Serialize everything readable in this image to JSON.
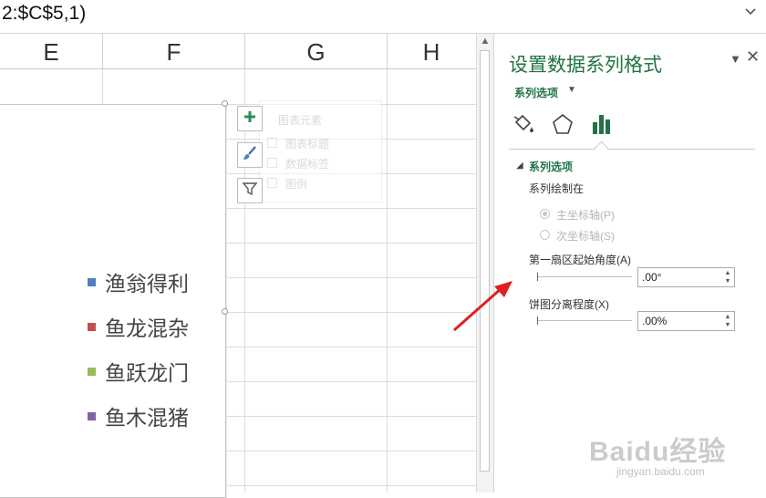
{
  "formula_bar": {
    "text": "2:$C$5,1)",
    "dropdown_icon": "chevron-down-icon"
  },
  "column_headers": [
    "E",
    "F",
    "G",
    "H"
  ],
  "chart": {
    "legend": [
      {
        "label": "渔翁得利",
        "color": "#4f81bd"
      },
      {
        "label": "鱼龙混杂",
        "color": "#c0504d"
      },
      {
        "label": "鱼跃龙门",
        "color": "#9bbb59"
      },
      {
        "label": "鱼木混猪",
        "color": "#8064a2"
      }
    ],
    "side_buttons": [
      "plus-icon",
      "brush-icon",
      "filter-icon"
    ],
    "elements_popup": {
      "title": "图表元素",
      "items": [
        "图表标题",
        "数据标签",
        "图例"
      ]
    }
  },
  "pane": {
    "title": "设置数据系列格式",
    "series_dropdown": "系列选项",
    "section_title": "系列选项",
    "plot_on_label": "系列绘制在",
    "radio_primary": "主坐标轴(P)",
    "radio_secondary": "次坐标轴(S)",
    "angle_label": "第一扇区起始角度(A)",
    "angle_value": ".00°",
    "explosion_label": "饼图分离程度(X)",
    "explosion_value": ".00%",
    "accent": "#217346"
  },
  "watermark": {
    "main": "Baidu经验",
    "url": "jingyan.baidu.com"
  }
}
